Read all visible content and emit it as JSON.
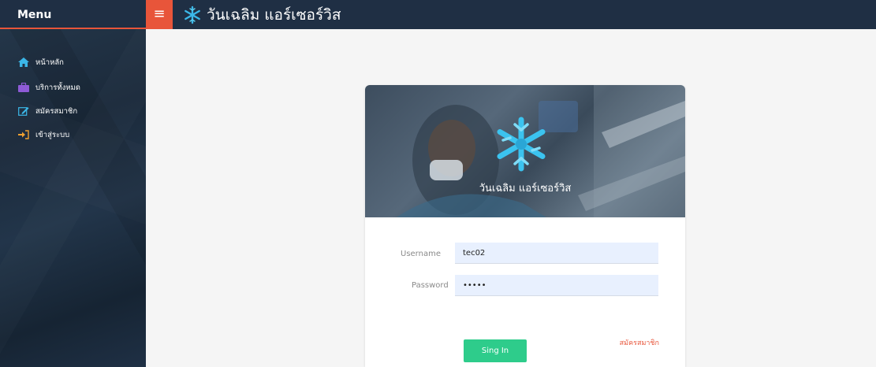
{
  "menu": {
    "title": "Menu",
    "toggle_icon": "hamburger-icon"
  },
  "brand": {
    "name": "วันเฉลิม แอร์เซอร์วิส",
    "icon": "snowflake-icon",
    "accent": "#3bb7e8"
  },
  "sidebar": {
    "items": [
      {
        "label": "หน้าหลัก",
        "icon": "home-icon",
        "color": "#3bb7e8"
      },
      {
        "label": "บริการทั้งหมด",
        "icon": "briefcase-icon",
        "color": "#8e5bd6"
      },
      {
        "label": "สมัครสมาชิก",
        "icon": "edit-icon",
        "color": "#3bb7e8"
      },
      {
        "label": "เข้าสู่ระบบ",
        "icon": "sign-in-icon",
        "color": "#f0a030"
      }
    ]
  },
  "login": {
    "hero_title": "วันเฉลิม แอร์เซอร์วิส",
    "username_label": "Username",
    "username_value": "tec02",
    "password_label": "Password",
    "password_value": "•••••",
    "signup_link": "สมัครสมาชิก",
    "signin_button": "Sing In"
  },
  "colors": {
    "topbar": "#1f2f44",
    "accent": "#e8553a",
    "button": "#2ecc8b"
  }
}
